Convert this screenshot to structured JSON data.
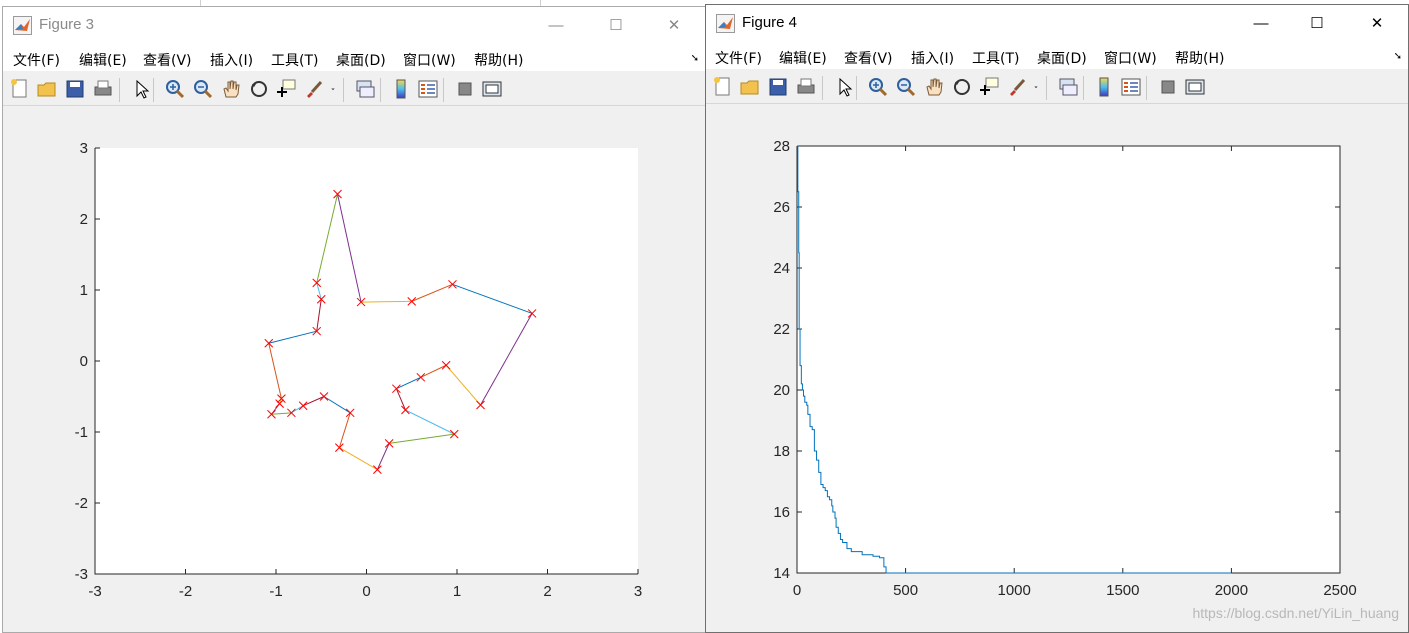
{
  "windows": [
    {
      "title": "Figure 3",
      "menu": [
        "文件(F)",
        "编辑(E)",
        "查看(V)",
        "插入(I)",
        "工具(T)",
        "桌面(D)",
        "窗口(W)",
        "帮助(H)"
      ]
    },
    {
      "title": "Figure 4",
      "menu": [
        "文件(F)",
        "编辑(E)",
        "查看(V)",
        "插入(I)",
        "工具(T)",
        "桌面(D)",
        "窗口(W)",
        "帮助(H)"
      ]
    }
  ],
  "caption_buttons": {
    "minimize": "—",
    "maximize": "☐",
    "close": "✕"
  },
  "toolbar_icons": [
    "new-figure-icon",
    "open-file-icon",
    "save-icon",
    "print-icon",
    "pointer-icon",
    "zoom-in-icon",
    "zoom-out-icon",
    "pan-hand-icon",
    "rotate-3d-icon",
    "data-cursor-icon",
    "brush-icon",
    "brush-dropdown-icon",
    "link-plot-icon",
    "colorbar-icon",
    "legend-icon",
    "hide-plot-tools-icon",
    "show-plot-tools-icon"
  ],
  "chart_data": [
    {
      "type": "line",
      "description_of_marks": "closed tour of points, red x markers, segments in default MATLAB color cycle",
      "xlim": [
        -3,
        3
      ],
      "ylim": [
        -3,
        3
      ],
      "xticks": [
        -3,
        -2,
        -1,
        0,
        1,
        2,
        3
      ],
      "yticks": [
        -3,
        -2,
        -1,
        0,
        1,
        2,
        3
      ],
      "grid": false,
      "marker": "x",
      "marker_color": "#ff0000",
      "line_colors": [
        "#0072bd",
        "#d95319",
        "#edb120",
        "#7e2f8e",
        "#77ac30",
        "#4dbeee",
        "#a2142f"
      ],
      "points": [
        [
          1.83,
          0.67
        ],
        [
          0.95,
          1.08
        ],
        [
          0.5,
          0.84
        ],
        [
          -0.06,
          0.83
        ],
        [
          -0.32,
          2.35
        ],
        [
          -0.55,
          1.1
        ],
        [
          -0.5,
          0.87
        ],
        [
          -0.55,
          0.42
        ],
        [
          -1.08,
          0.25
        ],
        [
          -0.94,
          -0.53
        ],
        [
          -0.96,
          -0.6
        ],
        [
          -1.05,
          -0.75
        ],
        [
          -0.83,
          -0.73
        ],
        [
          -0.7,
          -0.63
        ],
        [
          -0.47,
          -0.5
        ],
        [
          -0.18,
          -0.73
        ],
        [
          -0.3,
          -1.22
        ],
        [
          0.12,
          -1.53
        ],
        [
          0.25,
          -1.16
        ],
        [
          0.97,
          -1.03
        ],
        [
          0.43,
          -0.69
        ],
        [
          0.33,
          -0.39
        ],
        [
          0.6,
          -0.23
        ],
        [
          0.88,
          -0.06
        ],
        [
          1.26,
          -0.62
        ],
        [
          1.83,
          0.67
        ]
      ]
    },
    {
      "type": "line",
      "xlim": [
        0,
        2500
      ],
      "ylim": [
        14,
        28
      ],
      "xticks": [
        0,
        500,
        1000,
        1500,
        2000,
        2500
      ],
      "yticks": [
        14,
        16,
        18,
        20,
        22,
        24,
        26,
        28
      ],
      "grid": false,
      "series": [
        {
          "color": "#0072bd",
          "x": [
            0,
            4,
            8,
            10,
            14,
            20,
            25,
            30,
            36,
            45,
            50,
            60,
            70,
            80,
            90,
            100,
            110,
            120,
            130,
            140,
            150,
            160,
            165,
            175,
            180,
            190,
            200,
            210,
            230,
            250,
            300,
            350,
            380,
            400,
            410,
            2000
          ],
          "y": [
            28,
            26.5,
            24.5,
            22,
            20.8,
            20.2,
            20.0,
            19.8,
            19.6,
            19.5,
            19.2,
            18.8,
            18.7,
            18.0,
            17.7,
            17.3,
            16.9,
            16.8,
            16.7,
            16.5,
            16.4,
            16.2,
            16.0,
            15.8,
            15.5,
            15.3,
            15.1,
            15.0,
            14.8,
            14.7,
            14.6,
            14.55,
            14.5,
            14.2,
            14.0,
            14.0
          ]
        }
      ]
    }
  ],
  "watermark": "https://blog.csdn.net/YiLin_huang"
}
